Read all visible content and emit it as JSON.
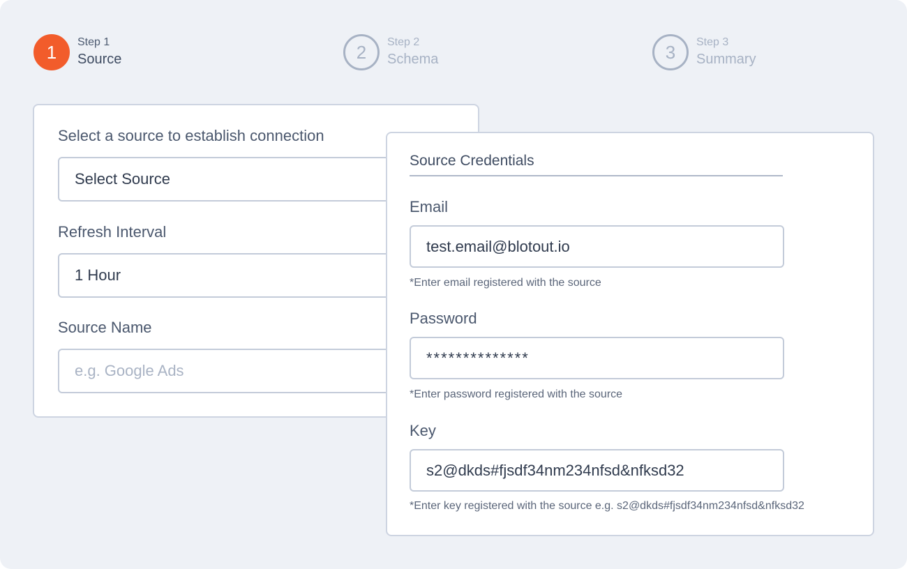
{
  "stepper": {
    "steps": [
      {
        "number": "1",
        "sub": "Step 1",
        "title": "Source"
      },
      {
        "number": "2",
        "sub": "Step 2",
        "title": "Schema"
      },
      {
        "number": "3",
        "sub": "Step 3",
        "title": "Summary"
      }
    ],
    "active_color": "#f25c2b"
  },
  "source_form": {
    "heading": "Select a source to establish connection",
    "source_select_value": "Select Source",
    "refresh_label": "Refresh Interval",
    "refresh_value": "1 Hour",
    "name_label": "Source Name",
    "name_placeholder": "e.g. Google Ads"
  },
  "credentials": {
    "title": "Source Credentials",
    "email_label": "Email",
    "email_value": "test.email@blotout.io",
    "email_hint": "*Enter email registered with the source",
    "password_label": "Password",
    "password_value": "**************",
    "password_hint": "*Enter password registered with the source",
    "key_label": "Key",
    "key_value": "s2@dkds#fjsdf34nm234nfsd&nfksd32",
    "key_hint": "*Enter key registered with the source e.g. s2@dkds#fjsdf34nm234nfsd&nfksd32"
  }
}
